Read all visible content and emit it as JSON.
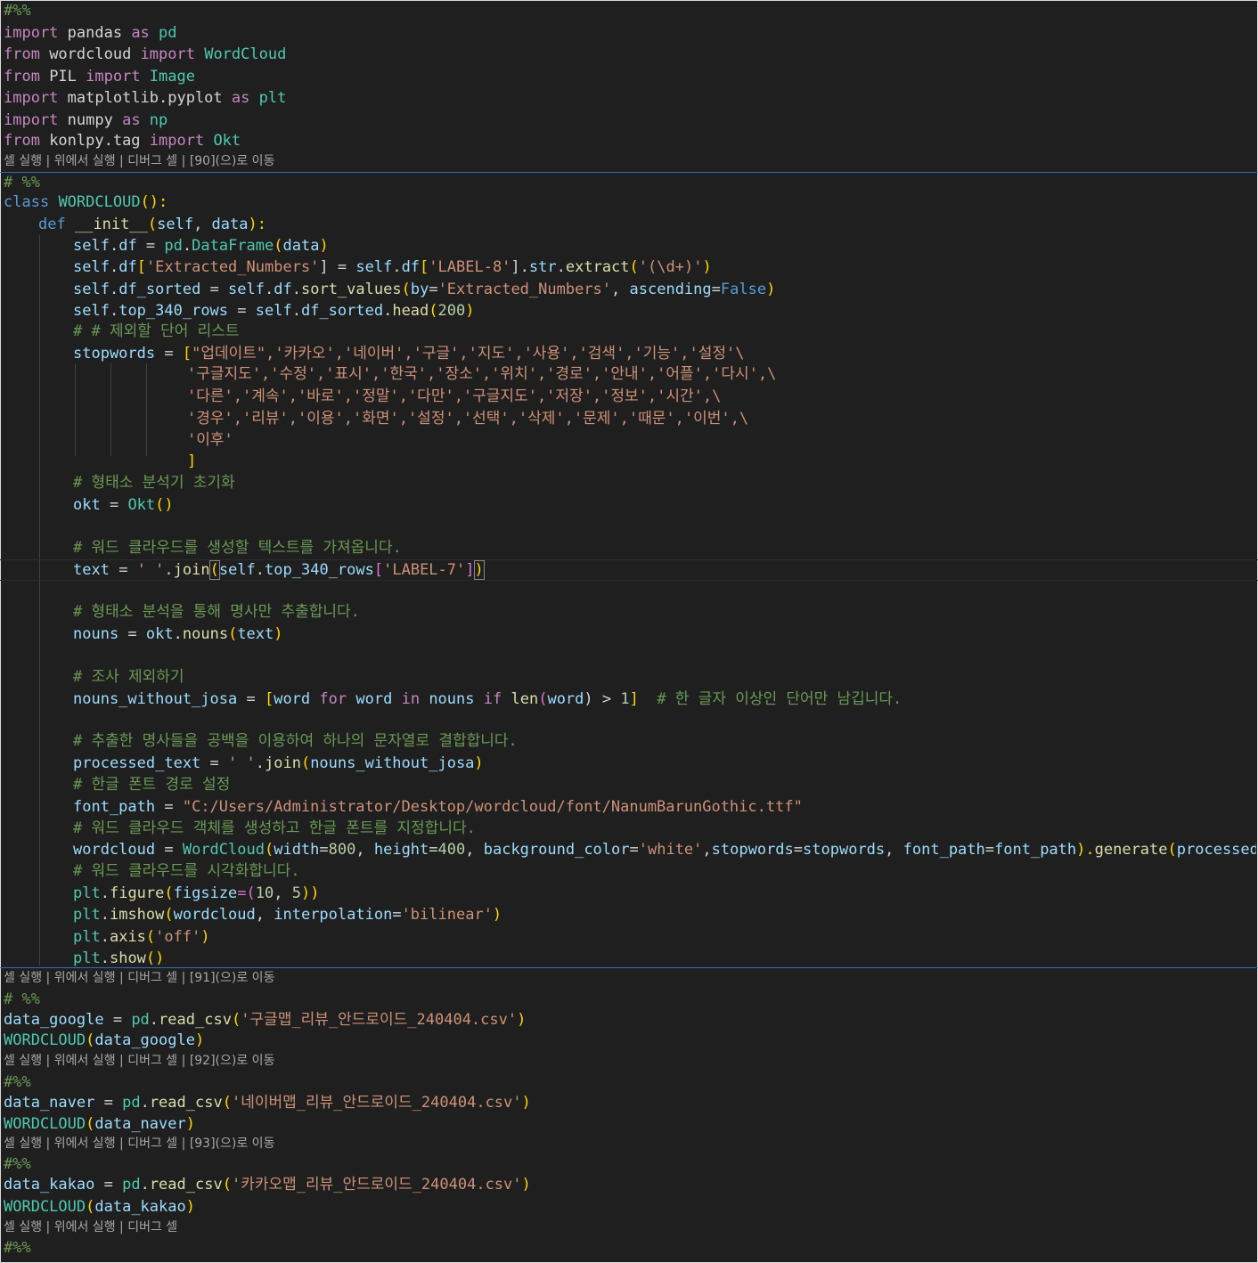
{
  "editor": {
    "colors": {
      "background": "#1f1f1f",
      "keyword": "#569cd6",
      "control": "#c586c0",
      "function": "#dcdcaa",
      "class": "#4ec9b0",
      "string": "#ce9178",
      "comment": "#6a9955",
      "variable": "#9cdcfe",
      "number": "#b5cea8",
      "separator": "#2f6dbd"
    },
    "codelens": {
      "run_cell": "셀 실행",
      "run_above": "위에서 실행",
      "debug_cell": "디버그 셀",
      "sep": " | ",
      "goto_90": "[90](으)로 이동",
      "goto_91": "[91](으)로 이동",
      "goto_92": "[92](으)로 이동",
      "goto_93": "[93](으)로 이동"
    },
    "code": {
      "l0": "#%%",
      "l1": {
        "a": "import",
        "b": " pandas ",
        "c": "as",
        "d": " pd"
      },
      "l2": {
        "a": "from",
        "b": " wordcloud ",
        "c": "import",
        "d": " WordCloud"
      },
      "l3": {
        "a": "from",
        "b": " PIL ",
        "c": "import",
        "d": " Image"
      },
      "l4": {
        "a": "import",
        "b": " matplotlib.pyplot ",
        "c": "as",
        "d": " plt"
      },
      "l5": {
        "a": "import",
        "b": " numpy ",
        "c": "as",
        "d": " np"
      },
      "l6": {
        "a": "from",
        "b": " konlpy.tag ",
        "c": "import",
        "d": " Okt"
      },
      "l8": "# %%",
      "l9": {
        "a": "class",
        "b": " ",
        "c": "WORDCLOUD",
        "d": "():"
      },
      "l10": {
        "a": "def",
        "b": " ",
        "c": "__init__",
        "d": "(",
        "e": "self",
        "f": ", ",
        "g": "data",
        "h": "):"
      },
      "l11": {
        "a": "self",
        "b": ".",
        "c": "df",
        "d": " = ",
        "e": "pd",
        "f": ".",
        "g": "DataFrame",
        "h": "(",
        "i": "data",
        "j": ")"
      },
      "l12": {
        "a": "self",
        "b": ".",
        "c": "df",
        "d": "[",
        "e": "'Extracted_Numbers'",
        "f": "] = ",
        "g": "self",
        "h": ".",
        "i": "df",
        "j": "[",
        "k": "'LABEL-8'",
        "l": "].",
        "m": "str",
        "n": ".",
        "o": "extract",
        "p": "(",
        "q": "'(\\d+)'",
        "r": ")"
      },
      "l13": {
        "a": "self",
        "b": ".",
        "c": "df_sorted",
        "d": " = ",
        "e": "self",
        "f": ".",
        "g": "df",
        "h": ".",
        "i": "sort_values",
        "j": "(",
        "k": "by",
        "l": "=",
        "m": "'Extracted_Numbers'",
        "n": ", ",
        "o": "ascending",
        "p": "=",
        "q": "False",
        "r": ")"
      },
      "l14": {
        "a": "self",
        "b": ".",
        "c": "top_340_rows",
        "d": " = ",
        "e": "self",
        "f": ".",
        "g": "df_sorted",
        "h": ".",
        "i": "head",
        "j": "(",
        "k": "200",
        "l": ")"
      },
      "l15": "# # 제외할 단어 리스트",
      "l16": {
        "a": "stopwords",
        "b": " = ",
        "c": "[",
        "d": "\"업데이트\",'카카오','네이버','구글','지도','사용','검색','기능','설정'\\"
      },
      "l17": "'구글지도','수정','표시','한국','장소','위치','경로','안내','어플','다시',\\",
      "l18": "'다른','계속','바로','정말','다만','구글지도','저장','정보','시간',\\",
      "l19": "'경우','리뷰','이용','화면','설정','선택','삭제','문제','때문','이번',\\",
      "l20": "'이후'",
      "l21": "]",
      "l22": "# 형태소 분석기 초기화",
      "l23": {
        "a": "okt",
        "b": " = ",
        "c": "Okt",
        "d": "()"
      },
      "l25": "# 워드 클라우드를 생성할 텍스트를 가져옵니다.",
      "l26": {
        "a": "text",
        "b": " = ",
        "c": "' '",
        "d": ".",
        "e": "join",
        "f": "(",
        "g": "self",
        "h": ".",
        "i": "top_340_rows",
        "j": "[",
        "k": "'LABEL-7'",
        "l": "]",
        "m": ")"
      },
      "l28": "# 형태소 분석을 통해 명사만 추출합니다.",
      "l29": {
        "a": "nouns",
        "b": " = ",
        "c": "okt",
        "d": ".",
        "e": "nouns",
        "f": "(",
        "g": "text",
        "h": ")"
      },
      "l31": "# 조사 제외하기",
      "l32": {
        "a": "nouns_without_josa",
        "b": " = ",
        "c": "[",
        "d": "word",
        "e": " ",
        "f": "for",
        "g": " ",
        "h": "word",
        "i": " ",
        "j": "in",
        "k": " ",
        "l": "nouns",
        "m": " ",
        "n": "if",
        "o": " ",
        "p": "len",
        "q": "(",
        "r": "word",
        "s": ") > ",
        "t": "1",
        "u": "]",
        "v": "  # 한 글자 이상인 단어만 남깁니다."
      },
      "l34": "# 추출한 명사들을 공백을 이용하여 하나의 문자열로 결합합니다.",
      "l35": {
        "a": "processed_text",
        "b": " = ",
        "c": "' '",
        "d": ".",
        "e": "join",
        "f": "(",
        "g": "nouns_without_josa",
        "h": ")"
      },
      "l36": "# 한글 폰트 경로 설정",
      "l37": {
        "a": "font_path",
        "b": " = ",
        "c": "\"C:/Users/Administrator/Desktop/wordcloud/font/NanumBarunGothic.ttf\""
      },
      "l38": "# 워드 클라우드 객체를 생성하고 한글 폰트를 지정합니다.",
      "l39": {
        "a": "wordcloud",
        "b": " = ",
        "c": "WordCloud",
        "d": "(",
        "e": "width",
        "f": "=",
        "g": "800",
        "h": ", ",
        "i": "height",
        "j": "=",
        "k": "400",
        "l": ", ",
        "m": "background_color",
        "n": "=",
        "o": "'white'",
        "p": ",",
        "q": "stopwords",
        "r": "=",
        "s": "stopwords",
        "t": ", ",
        "u": "font_path",
        "v": "=",
        "w": "font_path",
        "x": ").",
        "y": "generate",
        "z": "(",
        "aa": "processed_text",
        "ab": ")"
      },
      "l40": "# 워드 클라우드를 시각화합니다.",
      "l41": {
        "a": "plt",
        "b": ".",
        "c": "figure",
        "d": "(",
        "e": "figsize",
        "f": "=(",
        "g": "10",
        "h": ", ",
        "i": "5",
        "j": "))"
      },
      "l42": {
        "a": "plt",
        "b": ".",
        "c": "imshow",
        "d": "(",
        "e": "wordcloud",
        "f": ", ",
        "g": "interpolation",
        "h": "=",
        "i": "'bilinear'",
        "j": ")"
      },
      "l43": {
        "a": "plt",
        "b": ".",
        "c": "axis",
        "d": "(",
        "e": "'off'",
        "f": ")"
      },
      "l44": {
        "a": "plt",
        "b": ".",
        "c": "show",
        "d": "()"
      },
      "l46": "# %%",
      "l47": {
        "a": "data_google",
        "b": " = ",
        "c": "pd",
        "d": ".",
        "e": "read_csv",
        "f": "(",
        "g": "'구글맵_리뷰_안드로이드_240404.csv'",
        "h": ")"
      },
      "l48": {
        "a": "WORDCLOUD",
        "b": "(",
        "c": "data_google",
        "d": ")"
      },
      "l50": "#%%",
      "l51": {
        "a": "data_naver",
        "b": " = ",
        "c": "pd",
        "d": ".",
        "e": "read_csv",
        "f": "(",
        "g": "'네이버맵_리뷰_안드로이드_240404.csv'",
        "h": ")"
      },
      "l52": {
        "a": "WORDCLOUD",
        "b": "(",
        "c": "data_naver",
        "d": ")"
      },
      "l54": "#%%",
      "l55": {
        "a": "data_kakao",
        "b": " = ",
        "c": "pd",
        "d": ".",
        "e": "read_csv",
        "f": "(",
        "g": "'카카오맵_리뷰_안드로이드_240404.csv'",
        "h": ")"
      },
      "l56": {
        "a": "WORDCLOUD",
        "b": "(",
        "c": "data_kakao",
        "d": ")"
      },
      "l58": "#%%"
    }
  }
}
